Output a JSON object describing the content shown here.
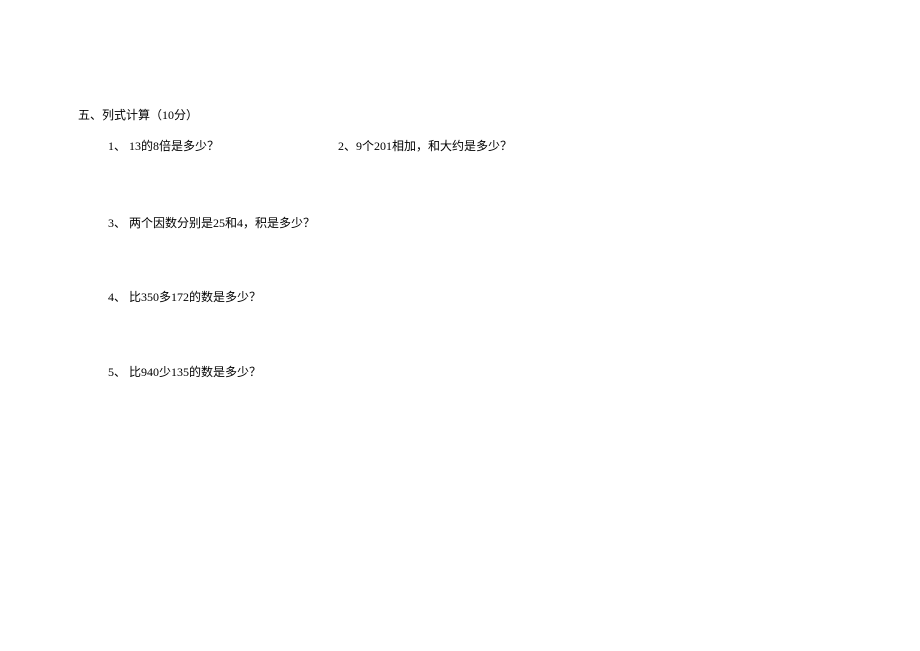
{
  "section": {
    "title": "五、列式计算（10分）"
  },
  "questions": {
    "q1": "1、 13的8倍是多少？",
    "q2": "2、9个201相加，和大约是多少？",
    "q3": "3、 两个因数分别是25和4，积是多少？",
    "q4": "4、 比350多172的数是多少？",
    "q5": "5、 比940少135的数是多少？"
  }
}
